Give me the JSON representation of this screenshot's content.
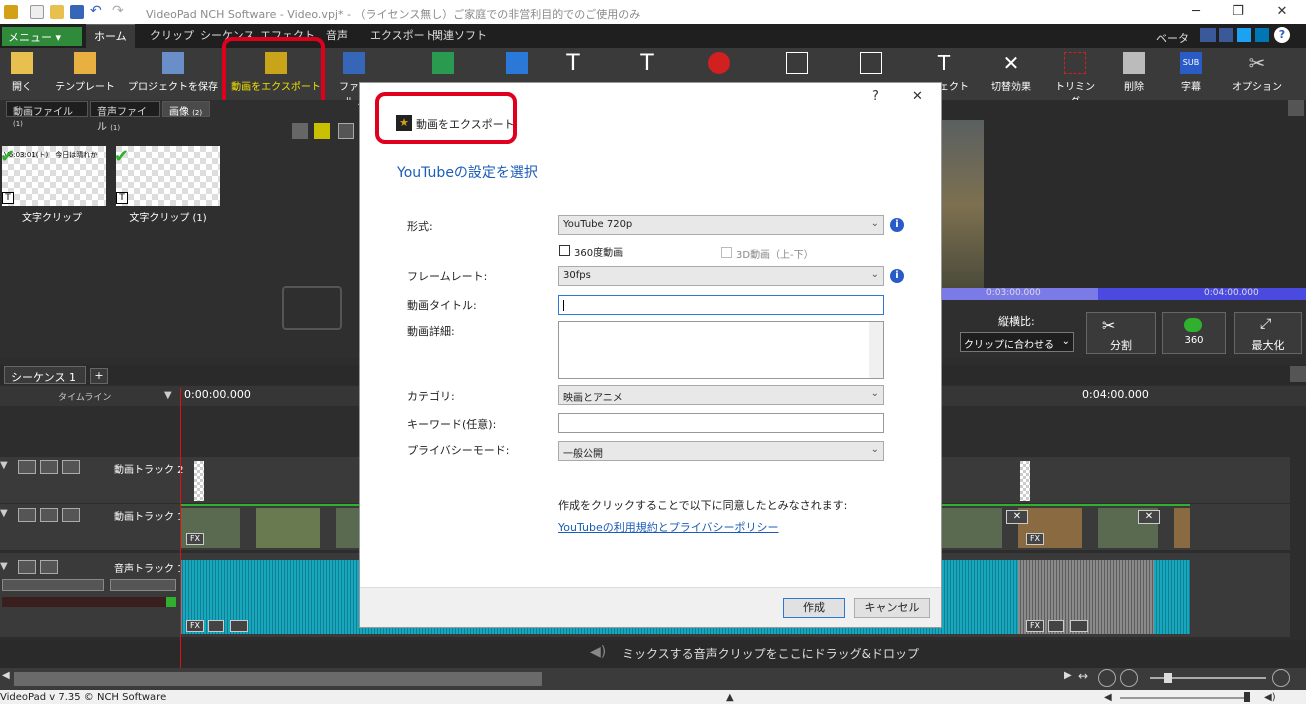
{
  "window": {
    "title": "VideoPad NCH Software - Video.vpj* - （ライセンス無し）ご家庭での非営利目的でのご使用のみ",
    "min": "─",
    "restore": "❐",
    "close": "✕"
  },
  "menubar": {
    "menu": "メニュー ▾",
    "tabs": [
      "ホーム",
      "クリップ",
      "シーケンス",
      "エフェクト",
      "音声",
      "エクスポート",
      "関連ソフト"
    ],
    "beta": "ベータ"
  },
  "ribbon": {
    "buttons": [
      "開く",
      "テンプレート",
      "プロジェクトを保存",
      "動画をエクスポート",
      "ファイル...",
      "",
      "",
      "",
      "",
      "",
      "",
      "",
      "",
      "",
      "",
      "エフェクト",
      "切替効果",
      "トリミング",
      "削除",
      "字幕",
      "オプション"
    ]
  },
  "bin": {
    "tabs": [
      "動画ファイル",
      "音声ファイル",
      "画像"
    ],
    "tab_counts": [
      "(1)",
      "(1)",
      "(2)"
    ],
    "clips": [
      "文字クリップ",
      "文字クリップ (1)"
    ],
    "clip_overlay": "V6:03:01(ト)　今日は晴れか"
  },
  "preview": {
    "t1": "0:03:00.000",
    "t2": "0:04:00.000",
    "aspect_label": "縦横比:",
    "aspect_value": "クリップに合わせる",
    "split": "分割",
    "maximize": "最大化",
    "sub": "SUB",
    "v360": "360"
  },
  "sequence": {
    "tab": "シーケンス 1",
    "add": "+",
    "timeline_label": "タイムライン",
    "t0": "0:00:00.000",
    "t1": "0:04:00.000"
  },
  "tracks": {
    "video2": "動画トラック 2",
    "video1": "動画トラック 1",
    "audio1": "音声トラック 1",
    "drop_hint": "ミックスする音声クリップをここにドラッグ&ドロップ",
    "fx": "FX"
  },
  "dialog": {
    "help": "?",
    "close": "✕",
    "title": "動画をエクスポート",
    "heading": "YouTubeの設定を選択",
    "format_label": "形式:",
    "format_value": "YouTube 720p",
    "cb360": "360度動画",
    "cb3d": "3D動画（上-下）",
    "fps_label": "フレームレート:",
    "fps_value": "30fps",
    "video_title_label": "動画タイトル:",
    "video_desc_label": "動画詳細:",
    "category_label": "カテゴリ:",
    "category_value": "映画とアニメ",
    "keywords_label": "キーワード(任意):",
    "privacy_label": "プライバシーモード:",
    "privacy_value": "一般公開",
    "agree_text": "作成をクリックすることで以下に同意したとみなされます:",
    "terms_link": "YouTubeの利用規約とプライバシーポリシー",
    "create": "作成",
    "cancel": "キャンセル"
  },
  "status": {
    "version": "VideoPad v 7.35 © NCH Software"
  },
  "colors": {
    "accent_green": "#2f8a3a",
    "highlight_red": "#e0001e",
    "link_blue": "#1a5cb8",
    "wave": "#19a7be"
  }
}
